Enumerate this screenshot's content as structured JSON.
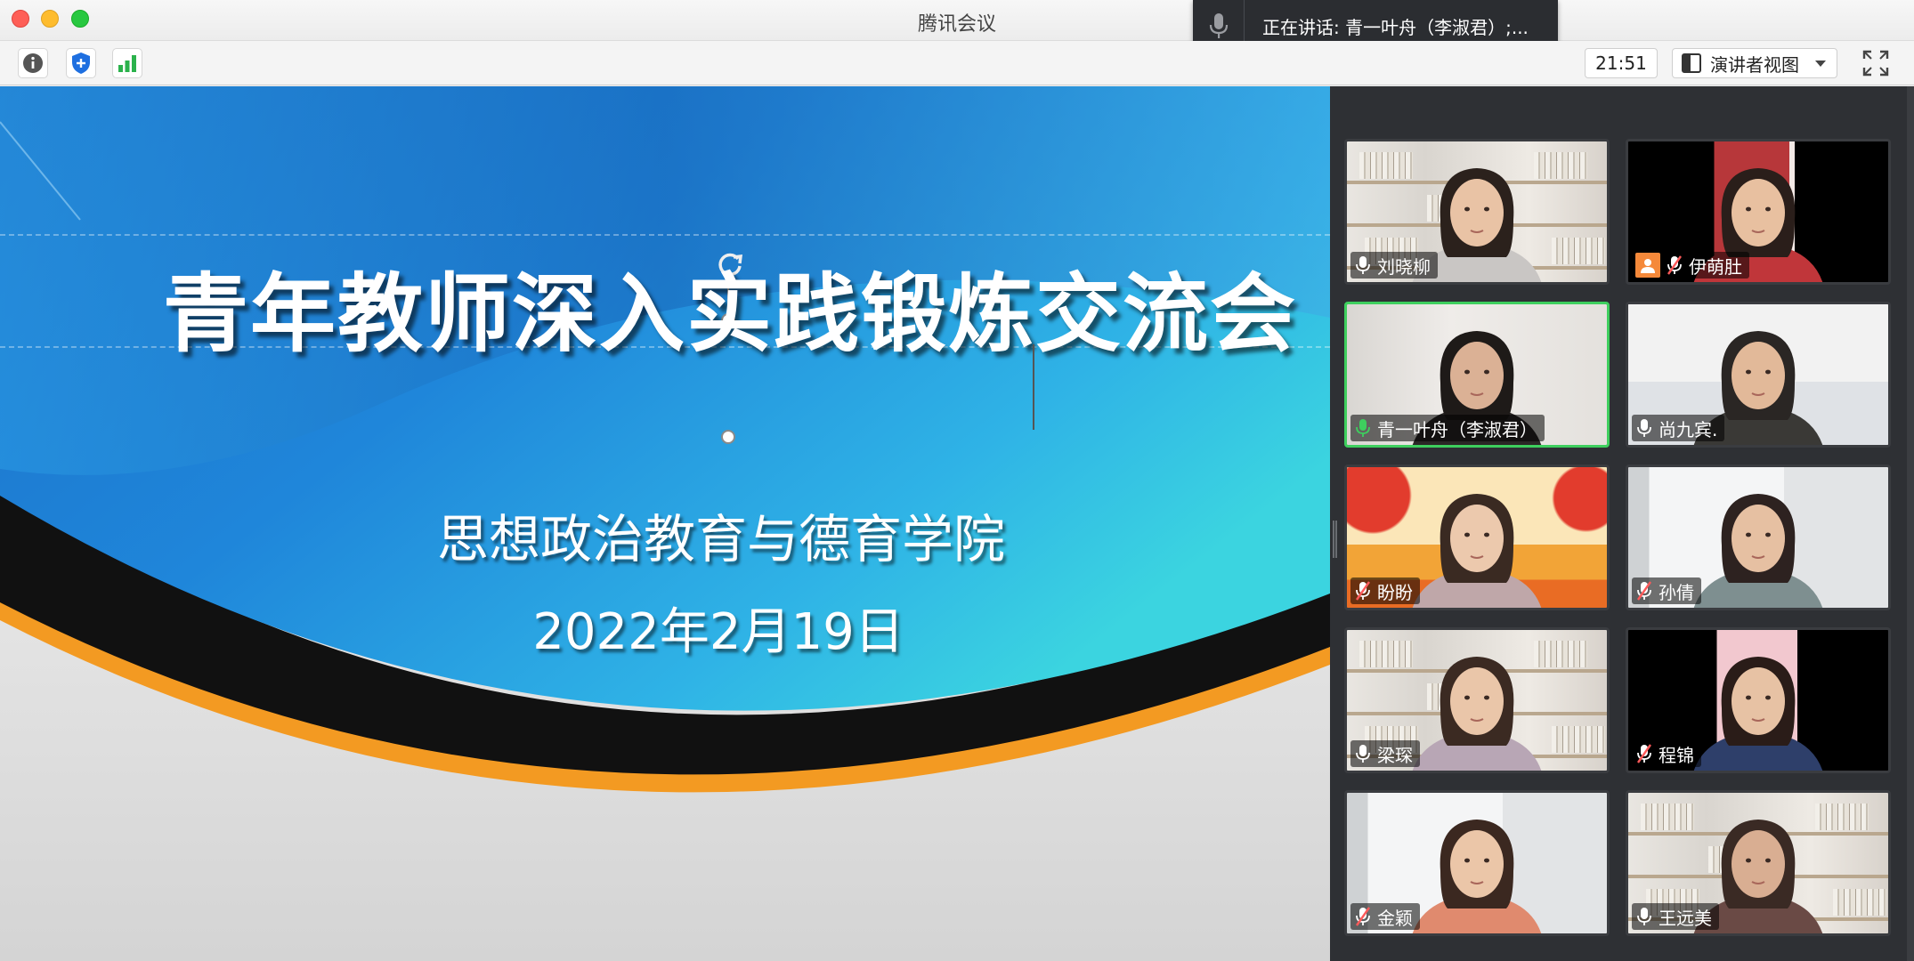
{
  "window": {
    "title": "腾讯会议"
  },
  "speaking": {
    "text": "正在讲话: 青一叶舟（李淑君）;..."
  },
  "toolbar": {
    "info_icon": "info-icon",
    "security_icon": "shield-icon",
    "signal_icon": "signal-bars-icon",
    "clock": "21:51",
    "view_mode": "演讲者视图",
    "fullscreen_icon": "fullscreen-icon"
  },
  "slide": {
    "title": "青年教师深入实践锻炼交流会",
    "subtitle": "思想政治教育与德育学院",
    "date": "2022年2月19日"
  },
  "participants": [
    {
      "name": "刘晓柳",
      "mic": "on",
      "active": false,
      "scene": "shelf"
    },
    {
      "name": "伊萌肚",
      "mic": "muted",
      "active": false,
      "scene": "dark-red",
      "badge": "avatar-icon"
    },
    {
      "name": "青一叶舟（李淑君）",
      "mic": "on",
      "active": true,
      "scene": "wall"
    },
    {
      "name": "尚九宾.",
      "mic": "on",
      "active": false,
      "scene": "office-blue"
    },
    {
      "name": "盼盼",
      "mic": "muted",
      "active": false,
      "scene": "festive"
    },
    {
      "name": "孙倩",
      "mic": "muted",
      "active": false,
      "scene": "office-white"
    },
    {
      "name": "梁琛",
      "mic": "on",
      "active": false,
      "scene": "shelf"
    },
    {
      "name": "程锦",
      "mic": "muted",
      "active": false,
      "scene": "dark-pink"
    },
    {
      "name": "金颖",
      "mic": "muted",
      "active": false,
      "scene": "office-white"
    },
    {
      "name": "王远美",
      "mic": "on",
      "active": false,
      "scene": "shelf"
    }
  ],
  "colors": {
    "active_border": "#3ecf5e",
    "slide_blue": "#1f7fd6",
    "slide_orange": "#f39a22",
    "muted_mic": "#ff5a5a"
  }
}
